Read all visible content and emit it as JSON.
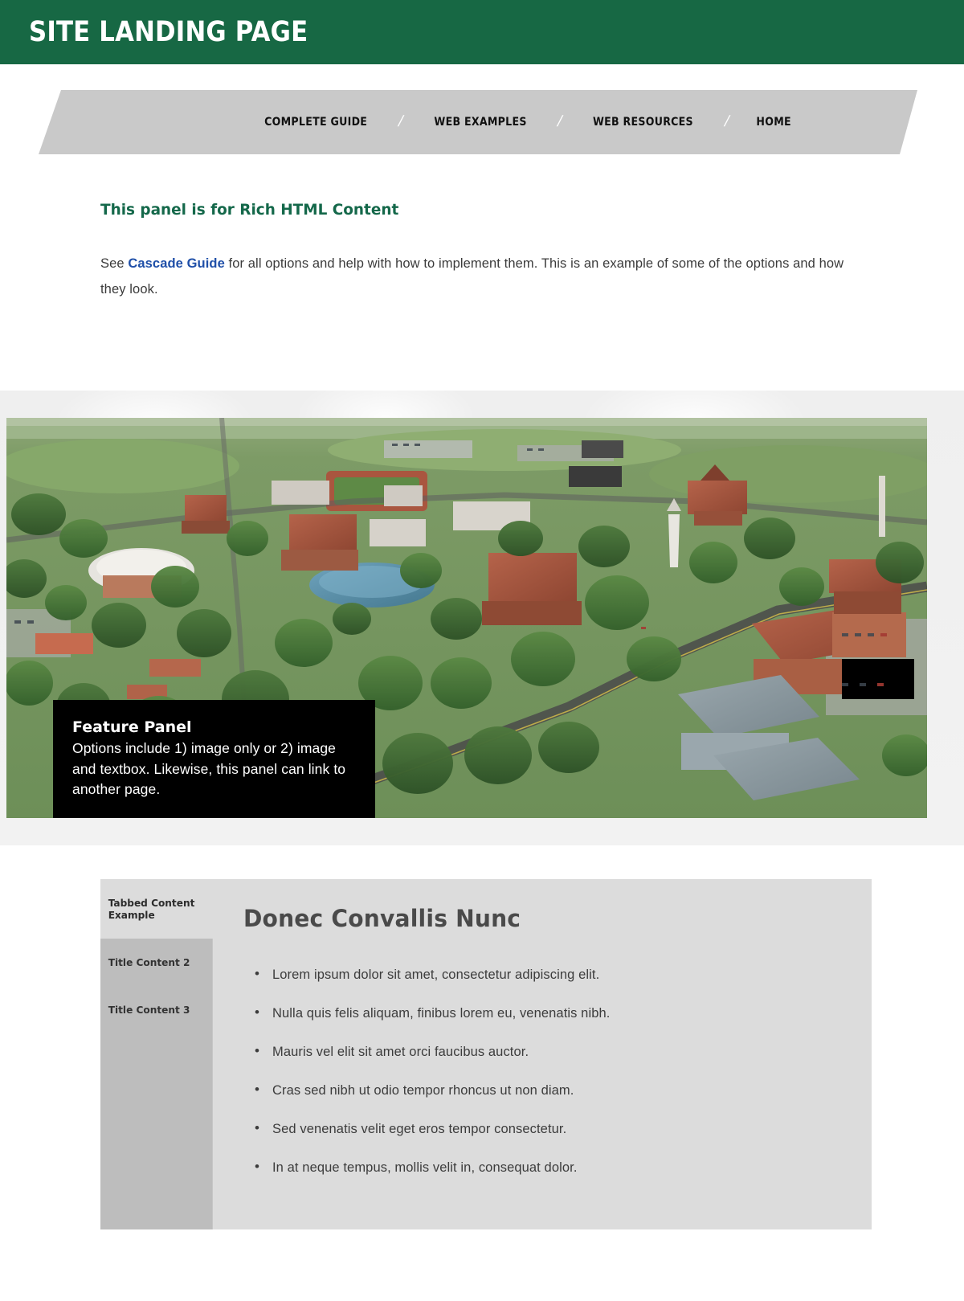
{
  "header": {
    "title": "SITE LANDING PAGE",
    "background_color": "#176844"
  },
  "nav": {
    "separator": "/",
    "items": [
      {
        "label": "COMPLETE GUIDE"
      },
      {
        "label": "WEB EXAMPLES"
      },
      {
        "label": "WEB RESOURCES"
      },
      {
        "label": "HOME"
      }
    ]
  },
  "rich_panel": {
    "heading": "This panel is for Rich HTML Content",
    "heading_color": "#14684a",
    "text_before_link": "See ",
    "link_label": "Cascade Guide",
    "link_color": "#1f4fa8",
    "text_after_link": " for all options and help with how to implement them.  This is an example of some of the options and how they look."
  },
  "feature": {
    "caption_title": "Feature Panel",
    "caption_text": "Options include 1) image only or 2) image and textbox. Likewise, this panel can link to another page.",
    "image_alt": "aerial-campus-photo",
    "caption_background": "#000000"
  },
  "tabbed": {
    "tabs": [
      {
        "label": "Tabbed Content Example",
        "active": true
      },
      {
        "label": "Title Content 2",
        "active": false
      },
      {
        "label": "Title Content 3",
        "active": false
      }
    ],
    "panel": {
      "title": "Donec Convallis Nunc",
      "bullets": [
        "Lorem ipsum dolor sit amet, consectetur adipiscing elit.",
        "Nulla quis felis aliquam, finibus lorem eu, venenatis nibh.",
        "Mauris vel elit sit amet orci faucibus auctor.",
        "Cras sed nibh ut odio tempor rhoncus ut non diam.",
        "Sed venenatis velit eget eros tempor consectetur.",
        "In at neque tempus, mollis velit in, consequat dolor."
      ]
    },
    "colors": {
      "panel_background": "#dcdcdc",
      "inactive_tab": "#bdbdbd"
    }
  }
}
